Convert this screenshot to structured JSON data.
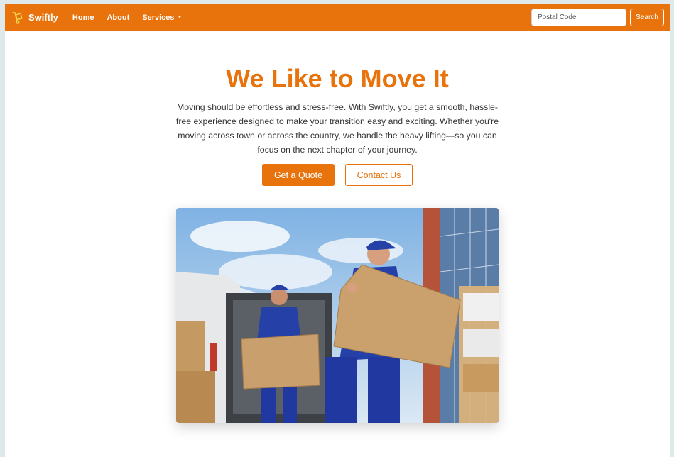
{
  "navbar": {
    "brand": "Swiftly",
    "brand_icon": "hand-truck-icon",
    "links": [
      {
        "label": "Home"
      },
      {
        "label": "About"
      },
      {
        "label": "Services",
        "has_dropdown": true
      }
    ],
    "search": {
      "placeholder": "Postal Code",
      "value": "",
      "button_label": "Search"
    }
  },
  "hero": {
    "title": "We Like to Move It",
    "description": "Moving should be effortless and stress-free. With Swiftly, you get a smooth, hassle-free experience designed to make your transition easy and exciting. Whether you're moving across town or across the country, we handle the heavy lifting—so you can focus on the next chapter of your journey.",
    "primary_button": "Get a Quote",
    "secondary_button": "Contact Us"
  },
  "colors": {
    "accent": "#e8720c",
    "background": "#ffffff",
    "text": "#333333"
  }
}
